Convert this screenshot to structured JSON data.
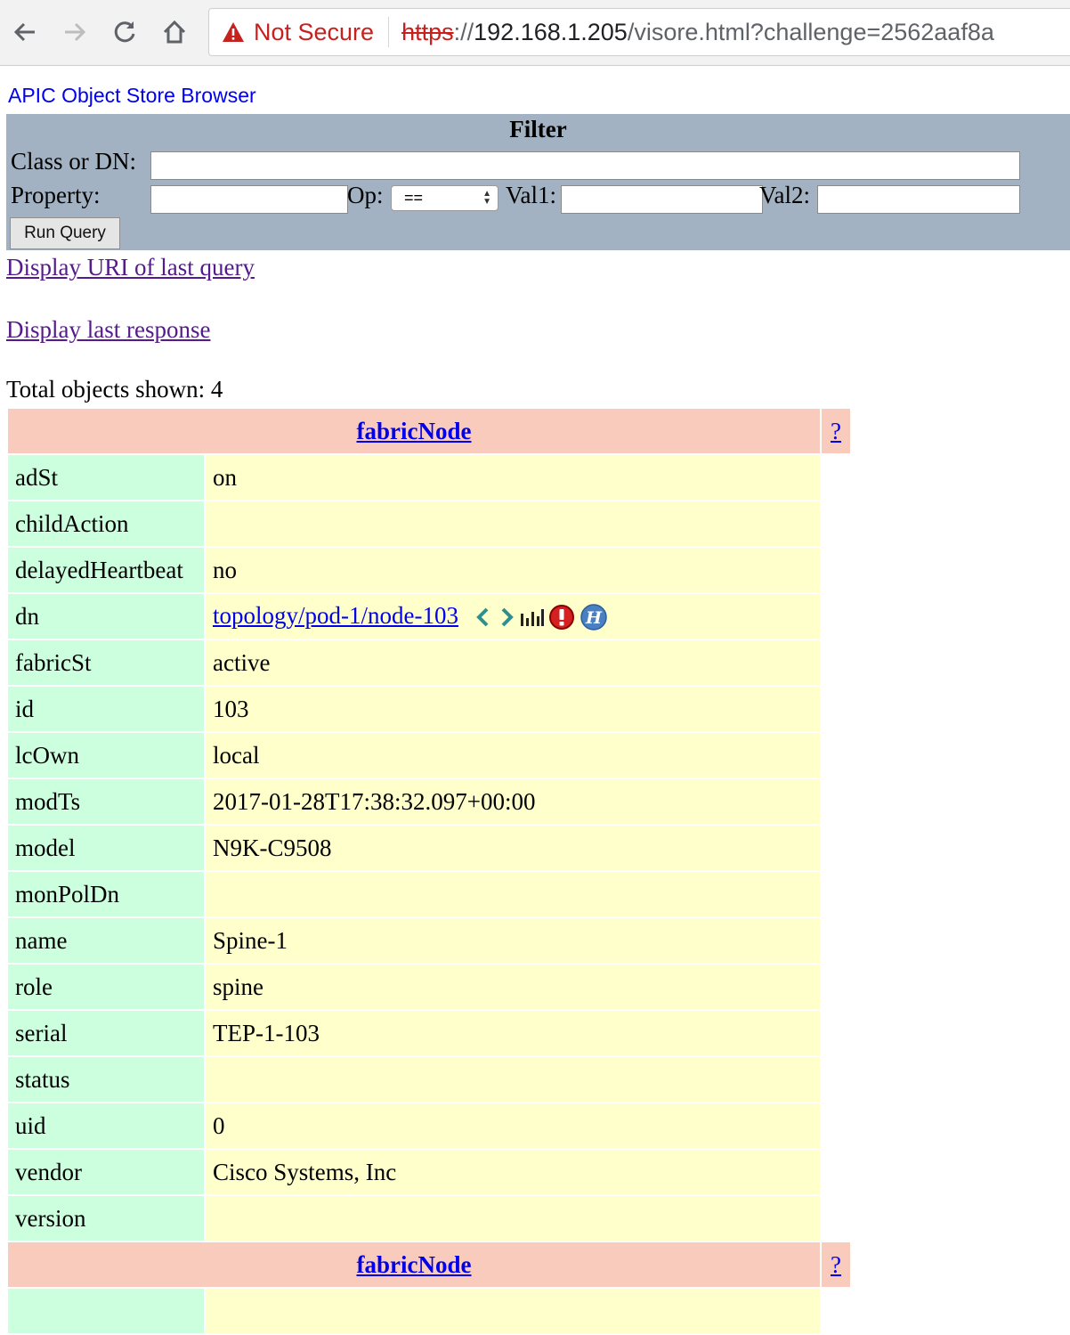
{
  "browser": {
    "security_label": "Not Secure",
    "url_scheme": "https",
    "url_sep": "://",
    "url_host": "192.168.1.205",
    "url_rest": "/visore.html?challenge=2562aaf8a"
  },
  "app": {
    "title": "APIC Object Store Browser"
  },
  "filter": {
    "title": "Filter",
    "class_label": "Class or DN:",
    "property_label": "Property:",
    "op_label": "Op:",
    "op_value": "==",
    "val1_label": "Val1:",
    "val2_label": "Val2:",
    "run_button": "Run Query"
  },
  "links": {
    "display_uri": "Display URI of last query",
    "display_response": "Display last response"
  },
  "total": "Total objects shown: 4",
  "objects": [
    {
      "class": "fabricNode",
      "help": "?",
      "props": [
        {
          "k": "adSt",
          "v": "on"
        },
        {
          "k": "childAction",
          "v": ""
        },
        {
          "k": "delayedHeartbeat",
          "v": "no"
        },
        {
          "k": "dn",
          "v": "topology/pod-1/node-103"
        },
        {
          "k": "fabricSt",
          "v": "active"
        },
        {
          "k": "id",
          "v": "103"
        },
        {
          "k": "lcOwn",
          "v": "local"
        },
        {
          "k": "modTs",
          "v": "2017-01-28T17:38:32.097+00:00"
        },
        {
          "k": "model",
          "v": "N9K-C9508"
        },
        {
          "k": "monPolDn",
          "v": ""
        },
        {
          "k": "name",
          "v": "Spine-1"
        },
        {
          "k": "role",
          "v": "spine"
        },
        {
          "k": "serial",
          "v": "TEP-1-103"
        },
        {
          "k": "status",
          "v": ""
        },
        {
          "k": "uid",
          "v": "0"
        },
        {
          "k": "vendor",
          "v": "Cisco Systems, Inc"
        },
        {
          "k": "version",
          "v": ""
        }
      ]
    },
    {
      "class": "fabricNode",
      "help": "?"
    }
  ],
  "icons": {
    "dn_actions": [
      "chevron-left-icon",
      "chevron-right-icon",
      "stats-icon",
      "faults-icon",
      "health-icon"
    ]
  },
  "colors": {
    "header_bg": "#f8cbbd",
    "key_bg": "#ccffdd",
    "value_bg": "#ffffcc",
    "filter_bg": "#a3b2c2",
    "link": "#0000ee",
    "visited_link": "#551a8b"
  }
}
